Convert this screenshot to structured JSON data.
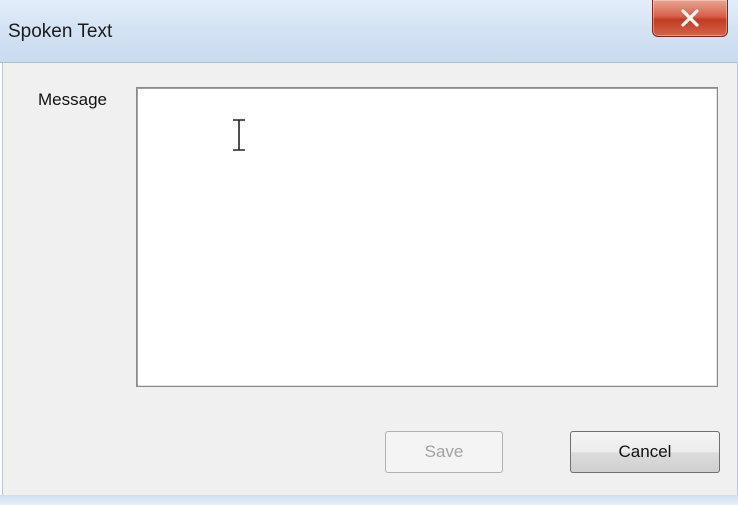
{
  "window": {
    "title": "Spoken Text"
  },
  "form": {
    "message_label": "Message",
    "message_value": ""
  },
  "buttons": {
    "save_label": "Save",
    "cancel_label": "Cancel"
  },
  "icons": {
    "close": "close-icon",
    "cursor": "text-cursor-icon"
  },
  "colors": {
    "titlebar": "#d4e3f4",
    "close_button": "#c84a30",
    "dialog_background": "#f0f0f0"
  }
}
